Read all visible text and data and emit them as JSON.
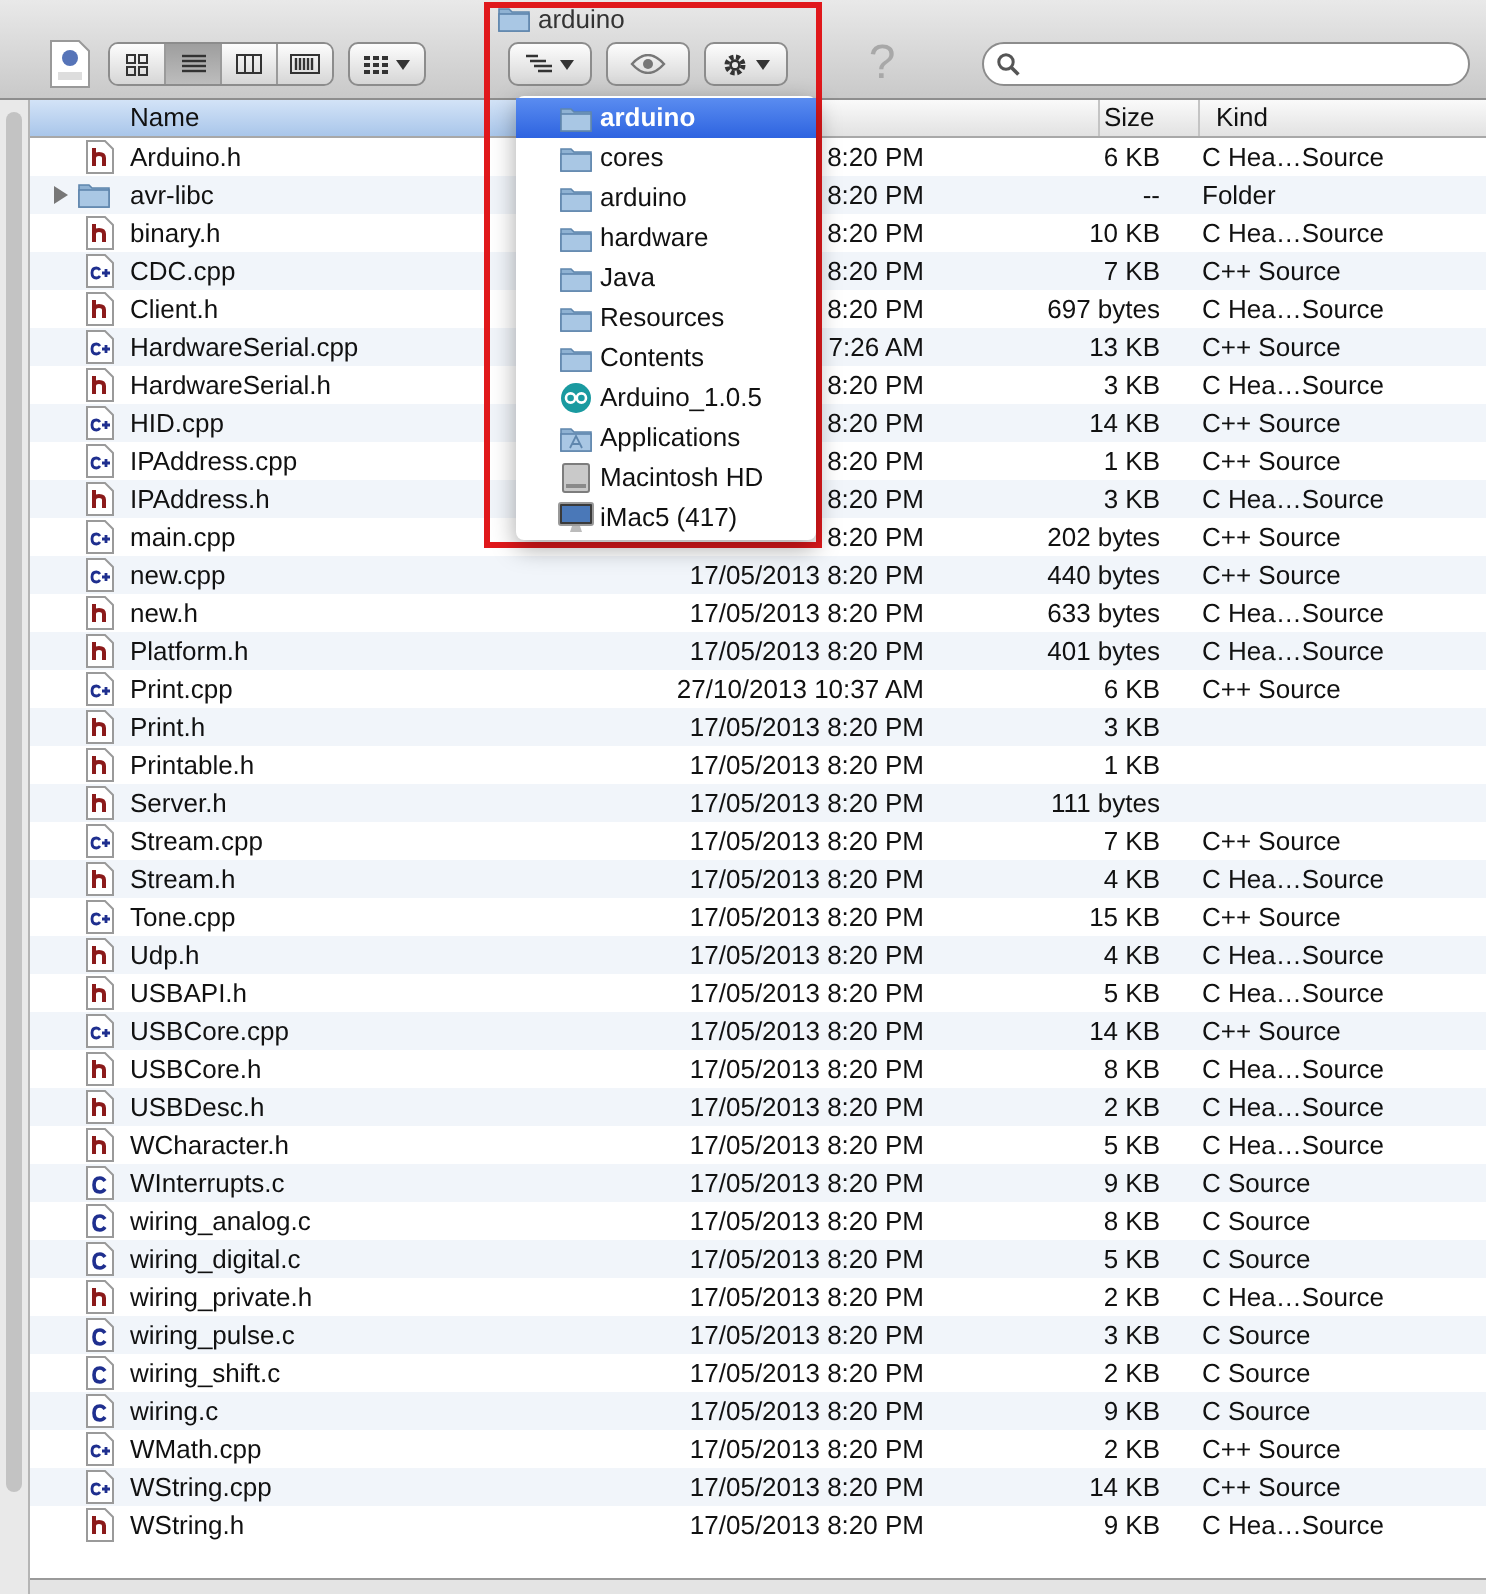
{
  "window": {
    "title": "arduino"
  },
  "toolbar": {
    "view_modes": [
      {
        "kind": "icons",
        "selected": false
      },
      {
        "kind": "list",
        "selected": true
      },
      {
        "kind": "columns",
        "selected": false
      },
      {
        "kind": "coverflow",
        "selected": false
      }
    ],
    "help": "?"
  },
  "path_menu": {
    "items": [
      {
        "kind": "folder",
        "label": "arduino",
        "selected": true
      },
      {
        "kind": "folder",
        "label": "cores",
        "selected": false
      },
      {
        "kind": "folder",
        "label": "arduino",
        "selected": false
      },
      {
        "kind": "folder",
        "label": "hardware",
        "selected": false
      },
      {
        "kind": "folder",
        "label": "Java",
        "selected": false
      },
      {
        "kind": "folder",
        "label": "Resources",
        "selected": false
      },
      {
        "kind": "folder",
        "label": "Contents",
        "selected": false
      },
      {
        "kind": "app",
        "label": "Arduino_1.0.5",
        "selected": false
      },
      {
        "kind": "apps",
        "label": "Applications",
        "selected": false
      },
      {
        "kind": "disk",
        "label": "Macintosh HD",
        "selected": false
      },
      {
        "kind": "computer",
        "label": "iMac5 (417)",
        "selected": false
      }
    ]
  },
  "table": {
    "columns": [
      {
        "label": "Name",
        "sorted": true
      },
      {
        "label": "Size",
        "sorted": false
      },
      {
        "label": "Kind",
        "sorted": false
      }
    ],
    "rows": [
      {
        "kind": "h",
        "name": "Arduino.h",
        "date": "8:20 PM",
        "size": "6 KB",
        "type": "C Hea…Source"
      },
      {
        "kind": "folder",
        "name": "avr-libc",
        "date": "8:20 PM",
        "size": "--",
        "type": "Folder",
        "expanded": false
      },
      {
        "kind": "h",
        "name": "binary.h",
        "date": "8:20 PM",
        "size": "10 KB",
        "type": "C Hea…Source"
      },
      {
        "kind": "cpp",
        "name": "CDC.cpp",
        "date": "8:20 PM",
        "size": "7 KB",
        "type": "C++ Source"
      },
      {
        "kind": "h",
        "name": "Client.h",
        "date": "8:20 PM",
        "size": "697 bytes",
        "type": "C Hea…Source"
      },
      {
        "kind": "cpp",
        "name": "HardwareSerial.cpp",
        "date": "7:26 AM",
        "size": "13 KB",
        "type": "C++ Source"
      },
      {
        "kind": "h",
        "name": "HardwareSerial.h",
        "date": "8:20 PM",
        "size": "3 KB",
        "type": "C Hea…Source"
      },
      {
        "kind": "cpp",
        "name": "HID.cpp",
        "date": "8:20 PM",
        "size": "14 KB",
        "type": "C++ Source"
      },
      {
        "kind": "cpp",
        "name": "IPAddress.cpp",
        "date": "8:20 PM",
        "size": "1 KB",
        "type": "C++ Source"
      },
      {
        "kind": "h",
        "name": "IPAddress.h",
        "date": "8:20 PM",
        "size": "3 KB",
        "type": "C Hea…Source"
      },
      {
        "kind": "cpp",
        "name": "main.cpp",
        "date": "8:20 PM",
        "size": "202 bytes",
        "type": "C++ Source"
      },
      {
        "kind": "cpp",
        "name": "new.cpp",
        "date": "17/05/2013 8:20 PM",
        "size": "440 bytes",
        "type": "C++ Source"
      },
      {
        "kind": "h",
        "name": "new.h",
        "date": "17/05/2013 8:20 PM",
        "size": "633 bytes",
        "type": "C Hea…Source"
      },
      {
        "kind": "h",
        "name": "Platform.h",
        "date": "17/05/2013 8:20 PM",
        "size": "401 bytes",
        "type": "C Hea…Source"
      },
      {
        "kind": "cpp",
        "name": "Print.cpp",
        "date": "27/10/2013 10:37 AM",
        "size": "6 KB",
        "type": "C++ Source"
      },
      {
        "kind": "h",
        "name": "Print.h",
        "date": "17/05/2013 8:20 PM",
        "size": "3 KB"
      },
      {
        "kind": "h",
        "name": "Printable.h",
        "date": "17/05/2013 8:20 PM",
        "size": "1 KB"
      },
      {
        "kind": "h",
        "name": "Server.h",
        "date": "17/05/2013 8:20 PM",
        "size": "111 bytes"
      },
      {
        "kind": "cpp",
        "name": "Stream.cpp",
        "date": "17/05/2013 8:20 PM",
        "size": "7 KB",
        "type": "C++ Source"
      },
      {
        "kind": "h",
        "name": "Stream.h",
        "date": "17/05/2013 8:20 PM",
        "size": "4 KB",
        "type": "C Hea…Source"
      },
      {
        "kind": "cpp",
        "name": "Tone.cpp",
        "date": "17/05/2013 8:20 PM",
        "size": "15 KB",
        "type": "C++ Source"
      },
      {
        "kind": "h",
        "name": "Udp.h",
        "date": "17/05/2013 8:20 PM",
        "size": "4 KB",
        "type": "C Hea…Source"
      },
      {
        "kind": "h",
        "name": "USBAPI.h",
        "date": "17/05/2013 8:20 PM",
        "size": "5 KB",
        "type": "C Hea…Source"
      },
      {
        "kind": "cpp",
        "name": "USBCore.cpp",
        "date": "17/05/2013 8:20 PM",
        "size": "14 KB",
        "type": "C++ Source"
      },
      {
        "kind": "h",
        "name": "USBCore.h",
        "date": "17/05/2013 8:20 PM",
        "size": "8 KB",
        "type": "C Hea…Source"
      },
      {
        "kind": "h",
        "name": "USBDesc.h",
        "date": "17/05/2013 8:20 PM",
        "size": "2 KB",
        "type": "C Hea…Source"
      },
      {
        "kind": "h",
        "name": "WCharacter.h",
        "date": "17/05/2013 8:20 PM",
        "size": "5 KB",
        "type": "C Hea…Source"
      },
      {
        "kind": "c",
        "name": "WInterrupts.c",
        "date": "17/05/2013 8:20 PM",
        "size": "9 KB",
        "type": "C Source"
      },
      {
        "kind": "c",
        "name": "wiring_analog.c",
        "date": "17/05/2013 8:20 PM",
        "size": "8 KB",
        "type": "C Source"
      },
      {
        "kind": "c",
        "name": "wiring_digital.c",
        "date": "17/05/2013 8:20 PM",
        "size": "5 KB",
        "type": "C Source"
      },
      {
        "kind": "h",
        "name": "wiring_private.h",
        "date": "17/05/2013 8:20 PM",
        "size": "2 KB",
        "type": "C Hea…Source"
      },
      {
        "kind": "c",
        "name": "wiring_pulse.c",
        "date": "17/05/2013 8:20 PM",
        "size": "3 KB",
        "type": "C Source"
      },
      {
        "kind": "c",
        "name": "wiring_shift.c",
        "date": "17/05/2013 8:20 PM",
        "size": "2 KB",
        "type": "C Source"
      },
      {
        "kind": "c",
        "name": "wiring.c",
        "date": "17/05/2013 8:20 PM",
        "size": "9 KB",
        "type": "C Source"
      },
      {
        "kind": "cpp",
        "name": "WMath.cpp",
        "date": "17/05/2013 8:20 PM",
        "size": "2 KB",
        "type": "C++ Source"
      },
      {
        "kind": "cpp",
        "name": "WString.cpp",
        "date": "17/05/2013 8:20 PM",
        "size": "14 KB",
        "type": "C++ Source"
      },
      {
        "kind": "h",
        "name": "WString.h",
        "date": "17/05/2013 8:20 PM",
        "size": "9 KB",
        "type": "C Hea…Source"
      }
    ]
  }
}
